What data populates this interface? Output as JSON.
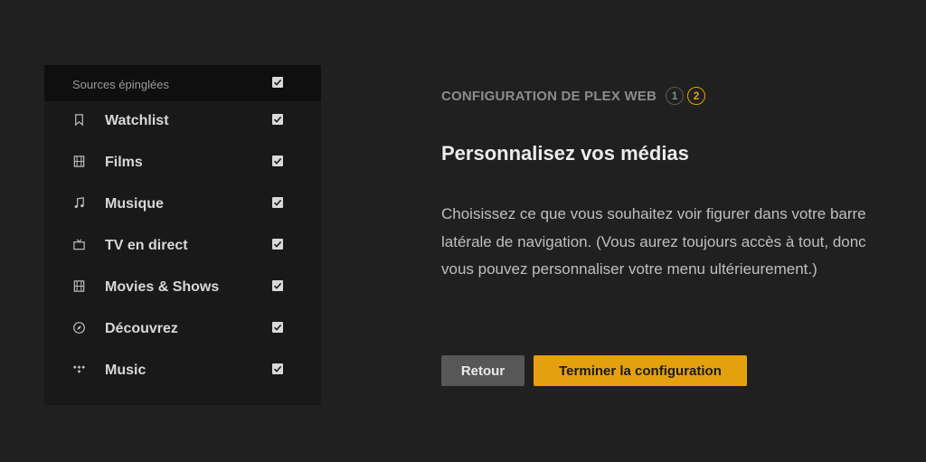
{
  "sidebar": {
    "header_label": "Sources épinglées",
    "header_checked": true,
    "items": [
      {
        "label": "Watchlist",
        "icon": "bookmark-icon",
        "checked": true
      },
      {
        "label": "Films",
        "icon": "film-icon",
        "checked": true
      },
      {
        "label": "Musique",
        "icon": "music-note-icon",
        "checked": true
      },
      {
        "label": "TV en direct",
        "icon": "tv-icon",
        "checked": true
      },
      {
        "label": "Movies & Shows",
        "icon": "film-icon",
        "checked": true
      },
      {
        "label": "Découvrez",
        "icon": "compass-icon",
        "checked": true
      },
      {
        "label": "Music",
        "icon": "tidal-icon",
        "checked": true
      }
    ]
  },
  "setup": {
    "title": "CONFIGURATION DE PLEX WEB",
    "steps": [
      "1",
      "2"
    ],
    "current_step": 2
  },
  "main": {
    "title": "Personnalisez vos médias",
    "description": "Choisissez ce que vous souhaitez voir figurer dans votre barre latérale de navigation. (Vous aurez toujours accès à tout, donc vous pouvez personnaliser votre menu ultérieurement.)"
  },
  "buttons": {
    "back_label": "Retour",
    "finish_label": "Terminer la configuration"
  },
  "colors": {
    "accent": "#e5a00d",
    "background": "#202020",
    "panel": "#191919"
  }
}
